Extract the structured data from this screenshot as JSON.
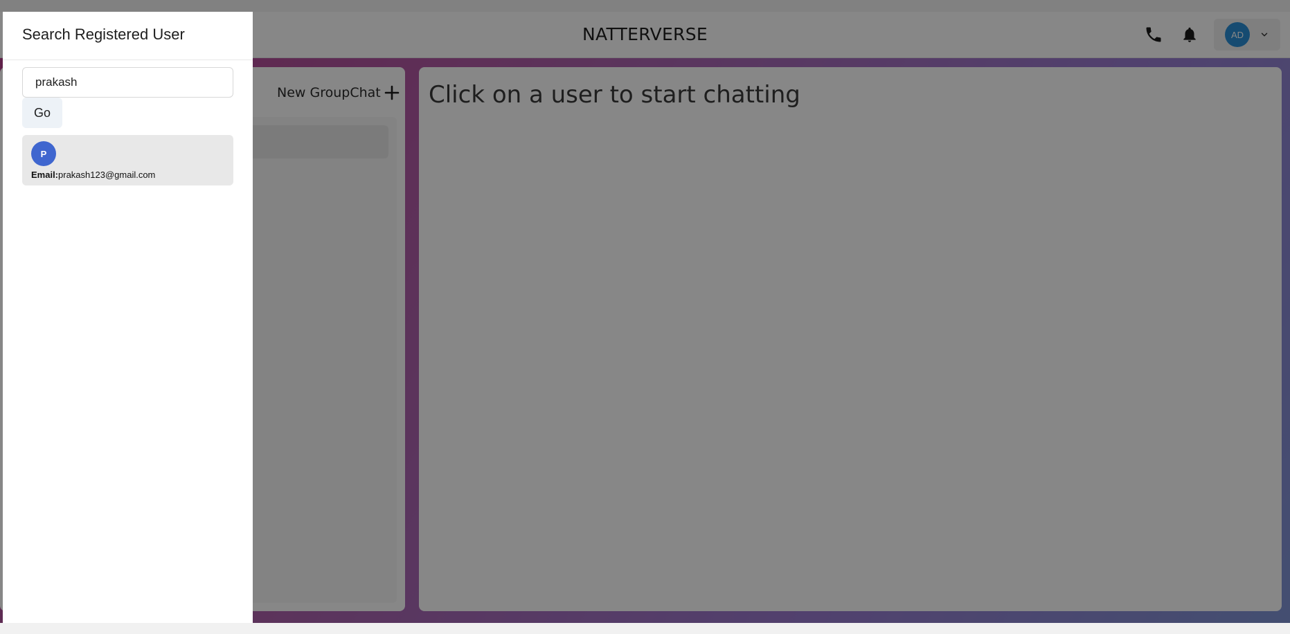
{
  "header": {
    "app_title": "NATTERVERSE",
    "icons": [
      "phone-icon",
      "bell-icon"
    ],
    "profile": {
      "avatar_initials": "AD"
    }
  },
  "chat_list_panel": {
    "new_group_chat_label": "New GroupChat"
  },
  "chat_panel": {
    "empty_message": "Click on a user to start chatting"
  },
  "drawer": {
    "title": "Search Registered User",
    "search": {
      "value": "prakash"
    },
    "go_label": "Go",
    "results": [
      {
        "avatar_initial": "P",
        "email_label": "Email:",
        "email": "prakash123@gmail.com"
      }
    ]
  },
  "colors": {
    "overlay": "#000000",
    "avatar_blue": "#2b8fd6",
    "result_avatar": "#3f66cf",
    "background_gradient": [
      "#b63f8b",
      "#7f95d6"
    ]
  }
}
